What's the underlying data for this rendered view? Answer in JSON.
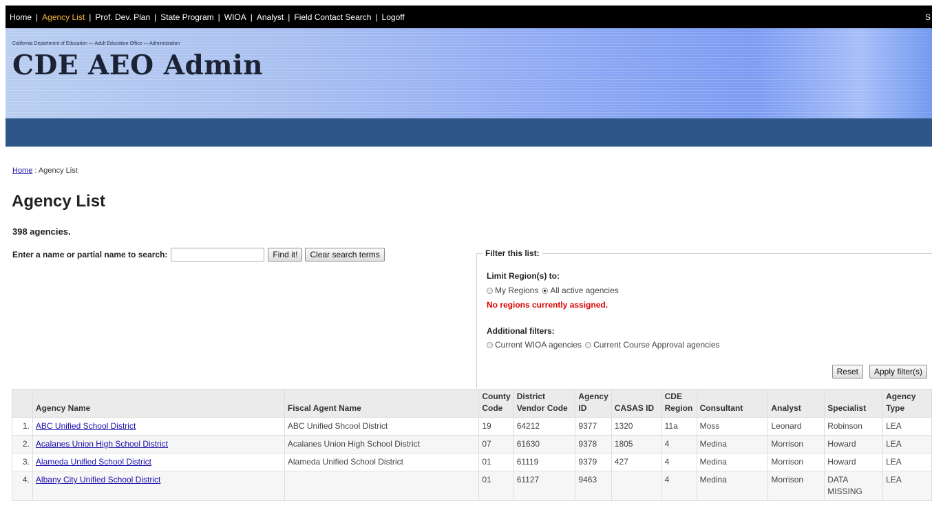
{
  "nav": {
    "items": [
      "Home",
      "Agency List",
      "Prof. Dev. Plan",
      "State Program",
      "WIOA",
      "Analyst",
      "Field Contact Search",
      "Logoff"
    ],
    "active_index": 1,
    "right_stub": "S",
    "separator": "|"
  },
  "banner": {
    "subtitle": "California Department of Education — Adult Education Office — Administration",
    "title": "CDE AEO Admin"
  },
  "breadcrumb": {
    "home": "Home",
    "sep": ":",
    "current": "Agency List"
  },
  "page_title": "Agency List",
  "count_text": "398 agencies.",
  "search": {
    "label": "Enter a name or partial name to search:",
    "value": "",
    "find_label": "Find it!",
    "clear_label": "Clear search terms"
  },
  "filter": {
    "legend": "Filter this list:",
    "limit_label": "Limit Region(s) to:",
    "opt_my_regions": "My Regions",
    "opt_all_active": "All active agencies",
    "warning": "No regions currently assigned.",
    "additional_label": "Additional filters:",
    "opt_wioa": "Current WIOA agencies",
    "opt_course": "Current Course Approval agencies",
    "reset_label": "Reset",
    "apply_label": "Apply filter(s)"
  },
  "table": {
    "headers": [
      "",
      "Agency Name",
      "Fiscal Agent Name",
      "County Code",
      "District Vendor Code",
      "Agency ID",
      "CASAS ID",
      "CDE Region",
      "Consultant",
      "Analyst",
      "Specialist",
      "Agency Type"
    ],
    "rows": [
      [
        "1.",
        "ABC Unified School District",
        "ABC Unified Shcool District",
        "19",
        "64212",
        "9377",
        "1320",
        "11a",
        "Moss",
        "Leonard",
        "Robinson",
        "LEA"
      ],
      [
        "2.",
        "Acalanes Union High School District",
        "Acalanes Union High School District",
        "07",
        "61630",
        "9378",
        "1805",
        "4",
        "Medina",
        "Morrison",
        "Howard",
        "LEA"
      ],
      [
        "3.",
        "Alameda Unified School District",
        "Alameda Unified School District",
        "01",
        "61119",
        "9379",
        "427",
        "4",
        "Medina",
        "Morrison",
        "Howard",
        "LEA"
      ],
      [
        "4.",
        "Albany City Unified School District",
        "",
        "01",
        "61127",
        "9463",
        "",
        "4",
        "Medina",
        "Morrison",
        "DATA MISSING",
        "LEA"
      ]
    ]
  }
}
